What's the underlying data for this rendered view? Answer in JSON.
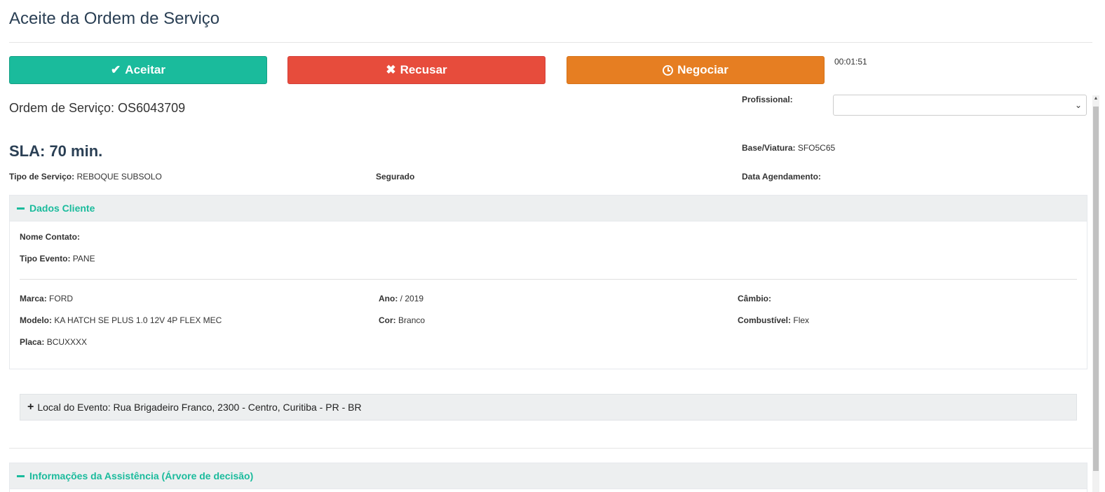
{
  "page": {
    "title": "Aceite da Ordem de Serviço"
  },
  "actions": {
    "accept_label": "Aceitar",
    "refuse_label": "Recusar",
    "negotiate_label": "Negociar",
    "timer": "00:01:51",
    "accept_color": "#1abb9c",
    "refuse_color": "#e74c3c",
    "negotiate_color": "#e67e22"
  },
  "order": {
    "number_text": "Ordem de Serviço: OS6043709",
    "sla_text": "SLA: 70 min.",
    "profissional_label": "Profissional:",
    "profissional_value": "",
    "base_label": "Base/Viatura:",
    "base_value": "SFO5C65",
    "tipo_servico_label": "Tipo de Serviço:",
    "tipo_servico_value": "REBOQUE SUBSOLO",
    "segurado_label": "Segurado",
    "data_agendamento_label": "Data Agendamento:"
  },
  "cliente": {
    "header": "Dados Cliente",
    "nome_contato_label": "Nome Contato:",
    "nome_contato_value": "",
    "tipo_evento_label": "Tipo Evento:",
    "tipo_evento_value": "PANE",
    "marca_label": "Marca:",
    "marca_value": "FORD",
    "ano_label": "Ano:",
    "ano_value": "/ 2019",
    "cambio_label": "Câmbio:",
    "cambio_value": "",
    "modelo_label": "Modelo:",
    "modelo_value": "KA HATCH SE PLUS 1.0 12V 4P FLEX MEC",
    "cor_label": "Cor:",
    "cor_value": "Branco",
    "combustivel_label": "Combustível:",
    "combustivel_value": "Flex",
    "placa_label": "Placa:",
    "placa_value": "BCUXXXX"
  },
  "local": {
    "text": "Local do Evento: Rua Brigadeiro Franco, 2300 - Centro, Curitiba - PR - BR"
  },
  "assistencia": {
    "header": "Informações da Assistência (Árvore de decisão)"
  },
  "icons": {
    "accept": "check-icon",
    "refuse": "times-icon",
    "negotiate": "clock-icon",
    "collapse": "minus-icon",
    "expand": "plus-icon",
    "select": "chevron-down-icon"
  }
}
